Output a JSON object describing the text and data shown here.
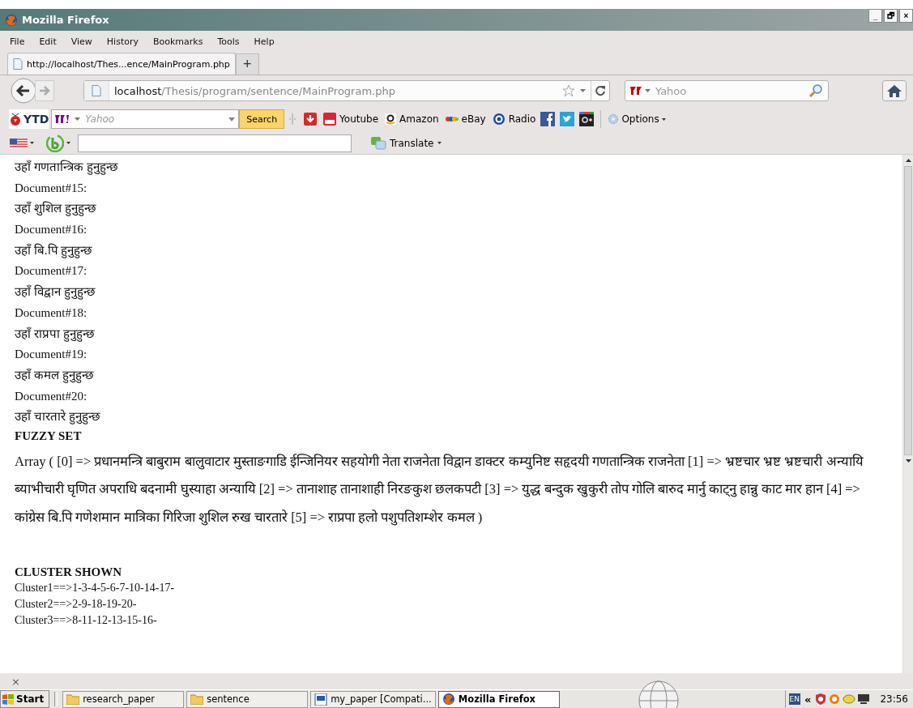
{
  "window": {
    "title": "Mozilla Firefox",
    "controls": [
      "_",
      "🗗",
      "×"
    ]
  },
  "menu": [
    "File",
    "Edit",
    "View",
    "History",
    "Bookmarks",
    "Tools",
    "Help"
  ],
  "tabs": [
    {
      "label": "http://localhost/Thes...ence/MainProgram.php",
      "selected": true
    }
  ],
  "new_tab": "+",
  "address": {
    "host": "localhost",
    "path": "/Thesis/program/sentence/MainProgram.php"
  },
  "search": {
    "placeholder": "Yahoo"
  },
  "ytd_toolbar": {
    "logo": "YTD",
    "search_placeholder": "Yahoo",
    "search_button": "Search",
    "links": [
      "Youtube",
      "Amazon",
      "eBay",
      "Radio"
    ],
    "options": "Options"
  },
  "translate_bar": {
    "button": "Translate"
  },
  "content": [
    {
      "kind": "text",
      "text": "उहाँ गणतान्त्रिक हुनुहुन्छ"
    },
    {
      "kind": "text",
      "text": "Document#15:"
    },
    {
      "kind": "text",
      "text": "उहाँ शुशिल हुनुहुन्छ"
    },
    {
      "kind": "text",
      "text": "Document#16:"
    },
    {
      "kind": "text",
      "text": "उहाँ बि.पि हुनुहुन्छ"
    },
    {
      "kind": "text",
      "text": "Document#17:"
    },
    {
      "kind": "text",
      "text": "उहाँ विद्वान हुनुहुन्छ"
    },
    {
      "kind": "text",
      "text": "Document#18:"
    },
    {
      "kind": "text",
      "text": "उहाँ राप्रपा हुनुहुन्छ"
    },
    {
      "kind": "text",
      "text": "Document#19:"
    },
    {
      "kind": "text",
      "text": "उहाँ कमल हुनुहुन्छ"
    },
    {
      "kind": "text",
      "text": "Document#20:"
    },
    {
      "kind": "text",
      "text": "उहाँ चारतारे हुनुहुन्छ"
    },
    {
      "kind": "heading",
      "text": "FUZZY SET"
    },
    {
      "kind": "paragraph",
      "text": "Array ( [0] => प्रधानमन्त्रि बाबुराम बालुवाटार मुस्ताङगाडि ईन्जिनियर सहयोगी नेता राजनेता विद्वान डाक्टर कम्युनिष्ट सहृदयी गणतान्त्रिक राजनेता [1] => भ्रष्टचार भ्रष्ट भ्रष्टचारी अन्यायि ब्याभीचारी घृणित अपराधि बदनामी घुस्याहा अन्यायि [2] => तानाशाह तानाशाही निरङकुश छलकपटी [3] => युद्ध बन्दुक खुकुरी तोप गोलि बारुद मार्नु काट्नु हान्नु काट मार हान [4] => कांग्रेस बि.पि गणेशमान मात्रिका गिरिजा शुशिल रुख चारतारे [5] => राप्रपा हलो पशुपतिशम्शेर कमल )"
    },
    {
      "kind": "heading",
      "text": "CLUSTER SHOWN"
    },
    {
      "kind": "small",
      "text": "Cluster1==>1-3-4-5-6-7-10-14-17-"
    },
    {
      "kind": "small",
      "text": "Cluster2==>2-9-18-19-20-"
    },
    {
      "kind": "small",
      "text": "Cluster3==>8-11-12-13-15-16-"
    }
  ],
  "status_bar": {
    "close": "×"
  },
  "taskbar": {
    "start": "Start",
    "items": [
      {
        "label": "research_paper",
        "kind": "folder",
        "selected": false
      },
      {
        "label": "sentence",
        "kind": "folder",
        "selected": false
      },
      {
        "label": "my_paper [Compati...",
        "kind": "document",
        "selected": false
      },
      {
        "label": "Mozilla Firefox",
        "kind": "browser",
        "selected": true
      }
    ],
    "language": "EN",
    "chevron": "«",
    "clock": "23:56"
  }
}
